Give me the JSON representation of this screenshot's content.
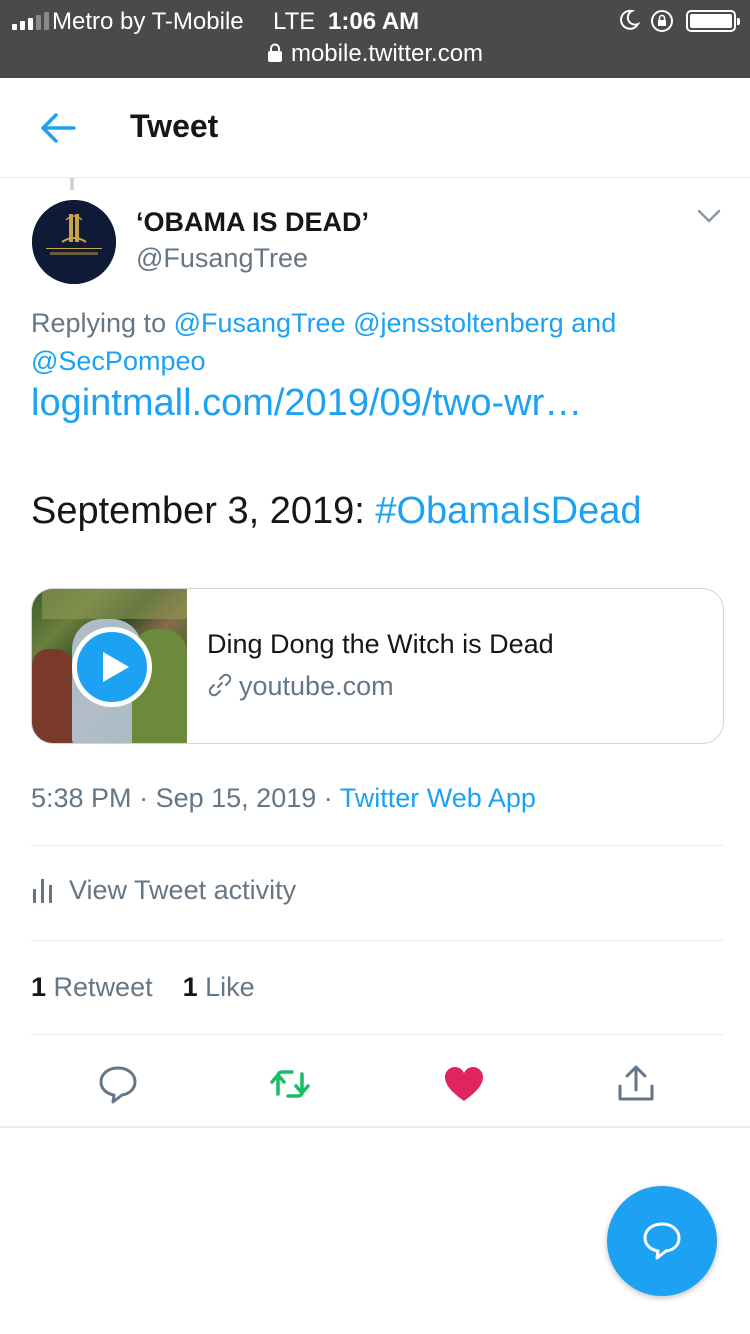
{
  "status_bar": {
    "carrier": "Metro by T-Mobile",
    "network": "LTE",
    "time": "1:06 AM",
    "url": "mobile.twitter.com",
    "signal_bars": 3,
    "signal_bars_total": 5,
    "icons": [
      "signal-icon",
      "moon-icon",
      "rotation-lock-icon",
      "battery-icon",
      "padlock-icon"
    ]
  },
  "header": {
    "title": "Tweet",
    "back_icon": "back-arrow-icon"
  },
  "tweet": {
    "display_name": "‘OBAMA IS DEAD’",
    "handle": "@FusangTree",
    "avatar_text": "South African Reserve Bank",
    "reply_prefix": "Replying to",
    "reply_to": [
      "@FusangTree",
      "@jensstoltenberg",
      "@SecPompeo"
    ],
    "reply_and": "and",
    "link": "logintmall.com/2019/09/two-wr…",
    "text_plain": "September 3, 2019: ",
    "hashtag": "#ObamaIsDead",
    "card": {
      "title": "Ding Dong the Witch is Dead",
      "domain": "youtube.com"
    },
    "time": "5:38 PM",
    "date": "Sep 15, 2019",
    "separator": "·",
    "source": "Twitter Web App",
    "activity_label": "View Tweet activity",
    "retweet_count": "1",
    "retweet_label": "Retweet",
    "like_count": "1",
    "like_label": "Like"
  },
  "colors": {
    "accent": "#1da1f2",
    "retweet_active": "#17bf63",
    "like_active": "#e0245e",
    "secondary_text": "#657786",
    "status_bar_bg": "#4a4a4a"
  }
}
